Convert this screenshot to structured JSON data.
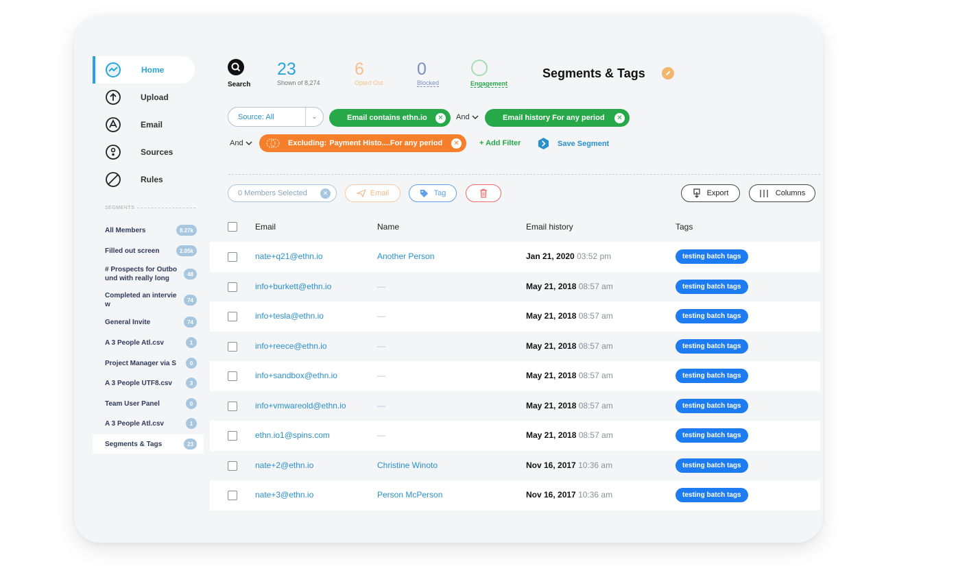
{
  "sidebar": {
    "nav": [
      {
        "label": "Home",
        "icon": "home-icon",
        "active": true
      },
      {
        "label": "Upload",
        "icon": "upload-icon"
      },
      {
        "label": "Email",
        "icon": "email-icon"
      },
      {
        "label": "Sources",
        "icon": "sources-icon"
      },
      {
        "label": "Rules",
        "icon": "rules-icon"
      }
    ],
    "segments_heading": "SEGMENTS",
    "segments": [
      {
        "label": "All Members",
        "count": "8.27k"
      },
      {
        "label": "Filled out screen",
        "count": "2.05k"
      },
      {
        "label": "# Prospects for Outbo\nund with really long",
        "count": "48"
      },
      {
        "label": "Completed an intervie\nw",
        "count": "74"
      },
      {
        "label": "General Invite",
        "count": "74"
      },
      {
        "label": "A 3 People Atl.csv",
        "count": "1"
      },
      {
        "label": "Project Manager via S",
        "count": "0"
      },
      {
        "label": "A 3 People UTF8.csv",
        "count": "3"
      },
      {
        "label": "Team User Panel",
        "count": "0"
      },
      {
        "label": "A 3 People Atl.csv",
        "count": "1"
      },
      {
        "label": "Segments & Tags",
        "count": "23"
      }
    ]
  },
  "stats": {
    "search_label": "Search",
    "shown": {
      "value": "23",
      "sub": "Shown of 8,274",
      "color": "#2aa4dc"
    },
    "opted_out": {
      "value": "6",
      "sub": "Opted Out",
      "color": "#f5c08a"
    },
    "blocked": {
      "value": "0",
      "sub": "Blocked",
      "color": "#7a8fc2"
    },
    "engagement": {
      "sub": "Engagement",
      "color": "#27a94a"
    }
  },
  "title": "Segments & Tags",
  "filters": {
    "source": "Source: All",
    "pill1": "Email contains ethn.io",
    "and": "And",
    "pill2": "Email history For any period",
    "excluding_prefix": "Excluding:",
    "pill3": "Payment Histo....For any period",
    "add_filter": "+ Add Filter",
    "save_segment": "Save Segment"
  },
  "actions": {
    "members_selected": "0 Members Selected",
    "email": "Email",
    "tag": "Tag",
    "export": "Export",
    "columns": "Columns"
  },
  "table": {
    "headers": {
      "email": "Email",
      "name": "Name",
      "history": "Email history",
      "tags": "Tags"
    },
    "rows": [
      {
        "email": "nate+q21@ethn.io",
        "name": "Another Person",
        "date": "Jan 21, 2020",
        "time": "03:52 pm",
        "tag": "testing batch tags"
      },
      {
        "email": "info+burkett@ethn.io",
        "name": "—",
        "date": "May 21, 2018",
        "time": "08:57 am",
        "tag": "testing batch tags"
      },
      {
        "email": "info+tesla@ethn.io",
        "name": "—",
        "date": "May 21, 2018",
        "time": "08:57 am",
        "tag": "testing batch tags"
      },
      {
        "email": "info+reece@ethn.io",
        "name": "—",
        "date": "May 21, 2018",
        "time": "08:57 am",
        "tag": "testing batch tags"
      },
      {
        "email": "info+sandbox@ethn.io",
        "name": "—",
        "date": "May 21, 2018",
        "time": "08:57 am",
        "tag": "testing batch tags"
      },
      {
        "email": "info+vmwareold@ethn.io",
        "name": "—",
        "date": "May 21, 2018",
        "time": "08:57 am",
        "tag": "testing batch tags"
      },
      {
        "email": "ethn.io1@spins.com",
        "name": "—",
        "date": "May 21, 2018",
        "time": "08:57 am",
        "tag": "testing batch tags"
      },
      {
        "email": "nate+2@ethn.io",
        "name": "Christine Winoto",
        "date": "Nov 16, 2017",
        "time": "10:36 am",
        "tag": "testing batch tags"
      },
      {
        "email": "nate+3@ethn.io",
        "name": "Person McPerson",
        "date": "Nov 16, 2017",
        "time": "10:36 am",
        "tag": "testing batch tags"
      }
    ]
  }
}
